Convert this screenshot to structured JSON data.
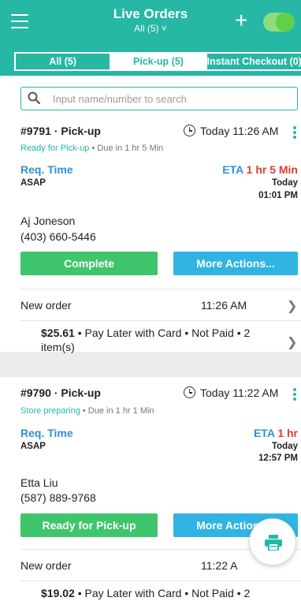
{
  "header": {
    "title": "Live Orders",
    "subtitle": "All (5) ˅",
    "plus": "+",
    "online_toggle": true
  },
  "tabs": [
    {
      "label": "All (5)",
      "active": false
    },
    {
      "label": "Pick-up (5)",
      "active": true
    },
    {
      "label": "Instant Checkout (0)",
      "active": false
    }
  ],
  "search": {
    "placeholder": "Input name/number to search"
  },
  "orders": [
    {
      "id": "#9791 · Pick-up",
      "time": "Today 11:26 AM",
      "status": "Ready for Pick-up",
      "due": " • Due in  1 hr 5 Min",
      "req_label": "Req. Time",
      "req_value": "ASAP",
      "eta_label": "ETA ",
      "eta_value": "1 hr 5 Min",
      "eta_day": "Today",
      "eta_time": "01:01 PM",
      "customer": "Aj Joneson",
      "phone": "(403) 660-5446",
      "primary_action": "Complete",
      "secondary_action": "More Actions...",
      "row_label": "New order",
      "row_time": "11:26 AM",
      "amount": "$25.61",
      "payment": " • Pay Later with Card • Not Paid • 2 item(s)"
    },
    {
      "id": "#9790 · Pick-up",
      "time": "Today 11:22 AM",
      "status": "Store preparing",
      "due": " • Due in  1 hr 1 Min",
      "req_label": "Req. Time",
      "req_value": "ASAP",
      "eta_label": "ETA ",
      "eta_value": "1 hr",
      "eta_day": "Today",
      "eta_time": "12:57 PM",
      "customer": "Etta Liu",
      "phone": "(587) 889-9768",
      "primary_action": "Ready for Pick-up",
      "secondary_action": "More Actions...",
      "row_label": "New order",
      "row_time": "11:22 A",
      "amount": "$19.02",
      "payment": " • Pay Later with Card • Not Paid • 2"
    }
  ],
  "colors": {
    "header": "#26b7a5",
    "accent_teal": "#26b7a5",
    "link_blue": "#2f8fd8",
    "eta_red": "#e23a2e",
    "button_green": "#3fc56b",
    "button_blue": "#31b3e4",
    "toggle_green": "#5fd147"
  },
  "icons": {
    "menu": "hamburger-menu-icon",
    "plus": "plus-icon",
    "search": "search-icon",
    "clock": "clock-icon",
    "kebab": "kebab-menu-icon",
    "chevron": "chevron-right-icon",
    "print": "printer-icon"
  }
}
